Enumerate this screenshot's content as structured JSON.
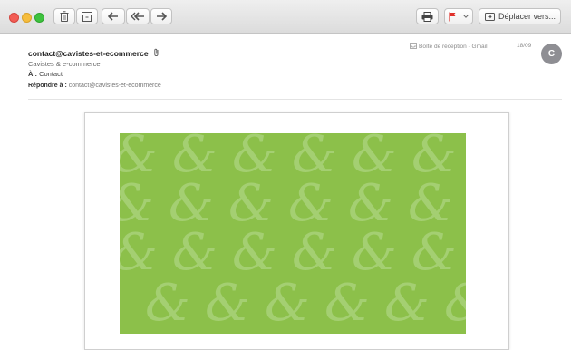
{
  "toolbar": {
    "buttons": [
      {
        "name": "trash-button",
        "icon": "trash-icon"
      },
      {
        "name": "archive-button",
        "icon": "archive-icon"
      },
      {
        "name": "reply-button",
        "icon": "reply-icon"
      },
      {
        "name": "reply-all-button",
        "icon": "reply-all-icon"
      },
      {
        "name": "forward-button",
        "icon": "forward-icon"
      },
      {
        "name": "print-button",
        "icon": "printer-icon"
      },
      {
        "name": "flag-button",
        "icon": "flag-icon"
      },
      {
        "name": "move-button",
        "icon": "folder-move-icon"
      }
    ],
    "move_label": "Déplacer vers...",
    "flag_color": "#e0312b"
  },
  "message": {
    "from": "contact@cavistes-et-ecommerce",
    "from_subtitle": "Cavistes & e-commerce",
    "to_label": "À :",
    "to": "Contact",
    "reply_to_label": "Répondre à :",
    "reply_to": "contact@cavistes-et-ecommerce",
    "mailbox": "Boîte de réception - Gmail",
    "date": "18/09",
    "avatar_initial": "C"
  },
  "colors": {
    "banner": "#8cc04a",
    "pattern": "#a9d27a",
    "avatar": "#8e8e93"
  },
  "banner": {
    "pattern_glyph": "&"
  }
}
